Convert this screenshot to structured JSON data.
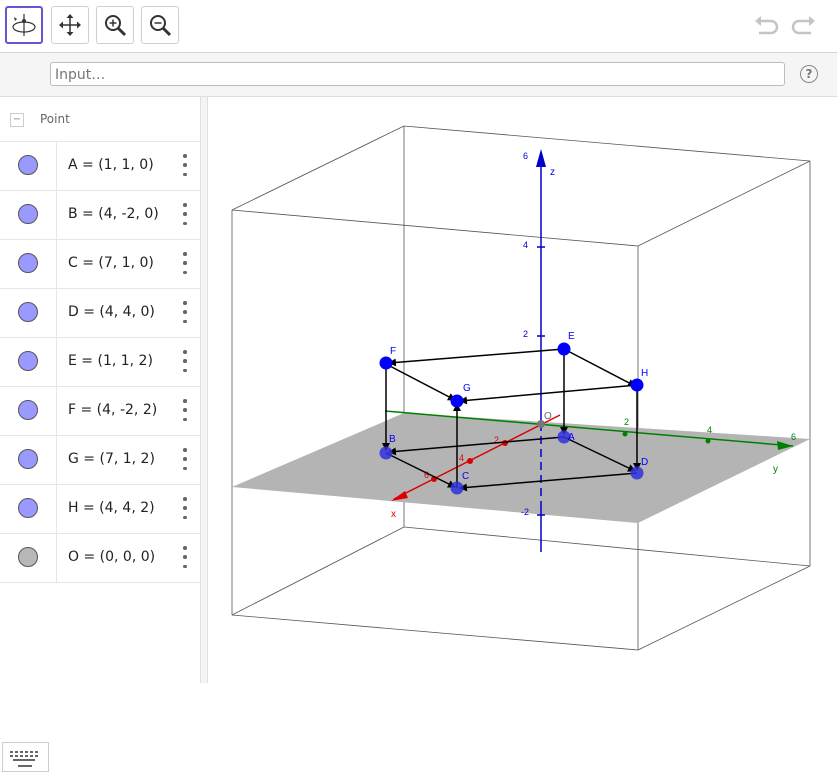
{
  "toolbar": {
    "tools": [
      {
        "name": "rotate-3d-view",
        "icon": "rotate-3d-icon"
      },
      {
        "name": "move-graphics-view",
        "icon": "move-arrows-icon"
      },
      {
        "name": "zoom-in",
        "icon": "zoom-in-icon"
      },
      {
        "name": "zoom-out",
        "icon": "zoom-out-icon"
      }
    ],
    "undo_icon": "undo-icon",
    "redo_icon": "redo-icon"
  },
  "input": {
    "placeholder": "Input…",
    "value": "",
    "help_label": "?"
  },
  "algebra": {
    "group_label": "Point",
    "collapse_symbol": "−",
    "rows": [
      {
        "expr": "A = (1, 1, 0)",
        "color": "#9999ff"
      },
      {
        "expr": "B = (4, -2, 0)",
        "color": "#9999ff"
      },
      {
        "expr": "C = (7, 1, 0)",
        "color": "#9999ff"
      },
      {
        "expr": "D = (4, 4, 0)",
        "color": "#9999ff"
      },
      {
        "expr": "E = (1, 1, 2)",
        "color": "#9999ff"
      },
      {
        "expr": "F = (4, -2, 2)",
        "color": "#9999ff"
      },
      {
        "expr": "G = (7, 1, 2)",
        "color": "#9999ff"
      },
      {
        "expr": "H = (4, 4, 2)",
        "color": "#9999ff"
      },
      {
        "expr": "O = (0, 0, 0)",
        "color": "#b8b8b8"
      }
    ]
  },
  "graphics": {
    "z_axis_label": "z",
    "x_axis_label": "x",
    "y_axis_label": "y",
    "z_ticks": [
      "6",
      "4",
      "2",
      "-2"
    ],
    "y_ticks": [
      "2",
      "4",
      "6"
    ],
    "x_ticks": [
      "2",
      "4",
      "6"
    ],
    "point_labels": {
      "A": "A",
      "B": "B",
      "C": "C",
      "D": "D",
      "E": "E",
      "F": "F",
      "G": "G",
      "H": "H",
      "O": "O"
    },
    "colors": {
      "point": "#0000ff",
      "x_axis": "#ff0000",
      "y_axis": "#008000",
      "z_axis": "#0000cc",
      "plane": "#b4b4b4"
    }
  }
}
